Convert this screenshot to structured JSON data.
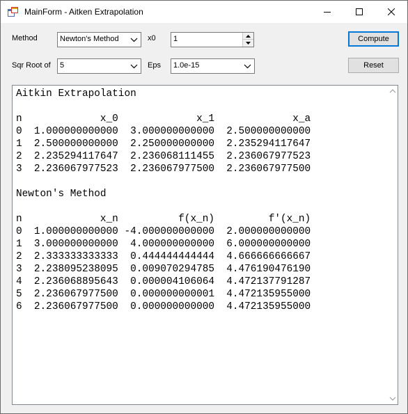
{
  "window": {
    "title": "MainForm - Aitken Extrapolation",
    "icons": [
      "app-icon",
      "minimize-icon",
      "maximize-icon",
      "close-icon"
    ]
  },
  "controls": {
    "method_label": "Method",
    "method_value": "Newton's Method",
    "x0_label": "x0",
    "x0_value": "1",
    "sqrt_label": "Sqr Root of",
    "sqrt_value": "5",
    "eps_label": "Eps",
    "eps_value": "1.0e-15",
    "compute_label": "Compute",
    "reset_label": "Reset"
  },
  "output": {
    "aitken_title": "Aitkin Extrapolation",
    "aitken_headers": [
      "n",
      "x_0",
      "x_1",
      "x_a"
    ],
    "aitken_rows": [
      [
        "0",
        "1.000000000000",
        "3.000000000000",
        "2.500000000000"
      ],
      [
        "1",
        "2.500000000000",
        "2.250000000000",
        "2.235294117647"
      ],
      [
        "2",
        "2.235294117647",
        "2.236068111455",
        "2.236067977523"
      ],
      [
        "3",
        "2.236067977523",
        "2.236067977500",
        "2.236067977500"
      ]
    ],
    "newton_title": "Newton's Method",
    "newton_headers": [
      "n",
      "x_n",
      "f(x_n)",
      "f'(x_n)"
    ],
    "newton_rows": [
      [
        "0",
        "1.000000000000",
        "-4.000000000000",
        "2.000000000000"
      ],
      [
        "1",
        "3.000000000000",
        "4.000000000000",
        "6.000000000000"
      ],
      [
        "2",
        "2.333333333333",
        "0.444444444444",
        "4.666666666667"
      ],
      [
        "3",
        "2.238095238095",
        "0.009070294785",
        "4.476190476190"
      ],
      [
        "4",
        "2.236068895643",
        "0.000004106064",
        "4.472137791287"
      ],
      [
        "5",
        "2.236067977500",
        "0.000000000001",
        "4.472135955000"
      ],
      [
        "6",
        "2.236067977500",
        "0.000000000000",
        "4.472135955000"
      ]
    ]
  }
}
